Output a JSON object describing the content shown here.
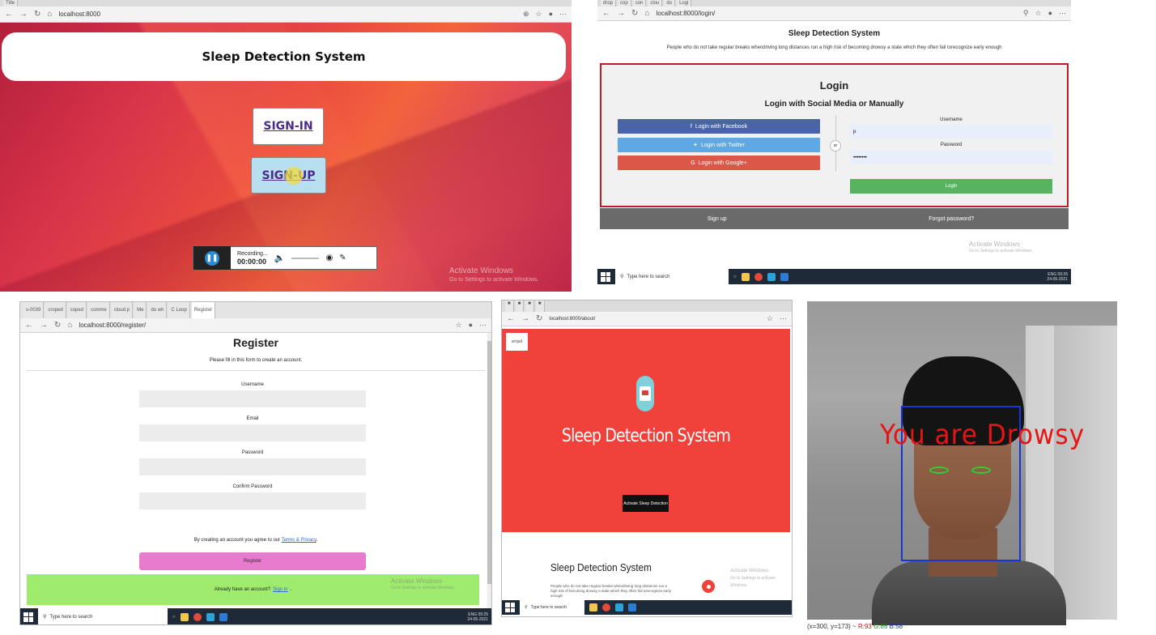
{
  "panel1": {
    "tab_title": "Title",
    "url": "localhost:8000",
    "header_title": "Sleep Detection System",
    "signin_label": "SIGN-IN",
    "signup_label": "SIGN-UP",
    "recorder": {
      "status": "Recording...",
      "time": "00:00:00"
    },
    "watermark": {
      "line1": "Activate Windows",
      "line2": "Go to Settings to activate Windows."
    }
  },
  "panel2": {
    "url": "localhost:8000/login/",
    "site_title": "Sleep Detection System",
    "tagline": "People who do not take regular breaks whendriving long distances run a high risk of becoming drowsy a state which they often fail torecognize early enough",
    "login_heading": "Login",
    "login_subheading": "Login with Social Media or Manually",
    "facebook_label": "Login with Facebook",
    "twitter_label": "Login with Twitter",
    "google_label": "Login with Google+",
    "or_label": "or",
    "username_label": "Username",
    "username_value": "p",
    "password_label": "Password",
    "password_value": "••••••••",
    "login_button": "Login",
    "signup_link": "Sign up",
    "forgot_link": "Forgot password?",
    "watermark": {
      "line1": "Activate Windows",
      "line2": "Go to Settings to activate Windows."
    },
    "taskbar": {
      "search": "Type here to search",
      "time": "09:26",
      "date": "24-05-2021",
      "lang": "ENG"
    }
  },
  "panel3": {
    "url": "localhost:8000/register/",
    "tabs": [
      "s-0039",
      "croped",
      "coped",
      "comme",
      "cloud.p",
      "Me",
      "do wh",
      "C Loop",
      "Register"
    ],
    "heading": "Register",
    "intro": "Please fill in this form to create an account.",
    "username_label": "Username",
    "email_label": "Email",
    "password_label": "Password",
    "confirm_label": "Confirm Password",
    "terms_prefix": "By creating an account you agree to our",
    "terms_link": "Terms & Privacy",
    "register_button": "Register",
    "already_text": "Already have an account?",
    "signin_link": "Sign in",
    "watermark": {
      "line1": "Activate Windows",
      "line2": "Go to Settings to activate Windows."
    },
    "taskbar": {
      "search": "Type here to search",
      "time": "09:25",
      "date": "24-05-2021",
      "lang": "ENG"
    }
  },
  "panel4": {
    "url": "localhost:8000/about/",
    "logo_text": "amjad",
    "title": "Sleep Detection System",
    "activate_button": "Activate Sleep Detection",
    "subtitle": "Sleep Detection System",
    "paragraph": "People who do not take regular breaks whendriving long distances run a high risk of becoming drowsy a state which they often fail torecognize early enough",
    "watermark": {
      "line1": "Activate Windows",
      "line2": "Go to Settings to activate Windows."
    },
    "taskbar": {
      "search": "Type here to search"
    }
  },
  "panel5": {
    "overlay_text": "You are Drowsy",
    "readout_coords": "(x=300, y=173) ~",
    "readout_r": "R:93",
    "readout_g": "G:86",
    "readout_b": "B:58"
  },
  "colors": {
    "facebook": "#4a65a7",
    "twitter": "#5ea8e6",
    "google": "#db5748",
    "login_green": "#57b35f",
    "login_border": "#c21b24",
    "register_pink": "#e97bcf",
    "signin_green": "#9feb6e",
    "about_red": "#f0413a",
    "drowsy_red": "#e61414",
    "face_box_blue": "#1a35d6",
    "eye_green": "#2fd02f"
  }
}
